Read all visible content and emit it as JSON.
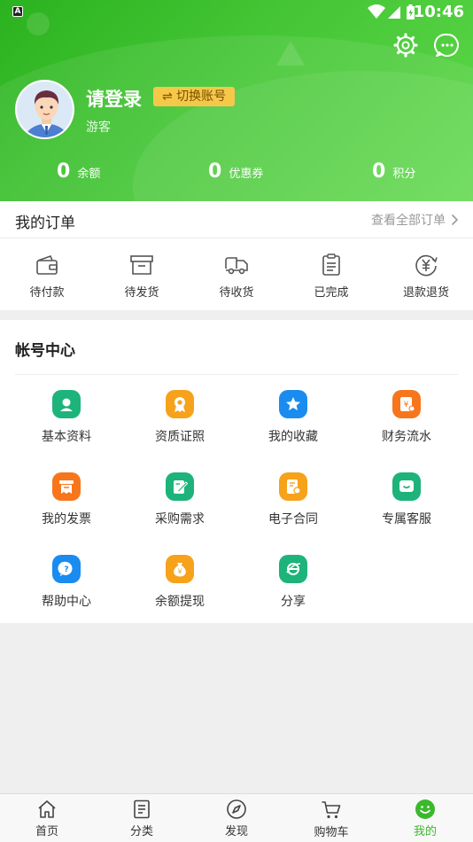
{
  "status_bar": {
    "time": "10:46",
    "badge": "A"
  },
  "profile": {
    "login_label": "请登录",
    "switch_label": "⇌ 切换账号",
    "role": "游客"
  },
  "stats": [
    {
      "value": "0",
      "label": "余额"
    },
    {
      "value": "0",
      "label": "优惠券"
    },
    {
      "value": "0",
      "label": "积分"
    }
  ],
  "orders": {
    "title": "我的订单",
    "view_all": "查看全部订单",
    "items": [
      {
        "label": "待付款",
        "icon": "wallet-icon"
      },
      {
        "label": "待发货",
        "icon": "box-icon"
      },
      {
        "label": "待收货",
        "icon": "truck-icon"
      },
      {
        "label": "已完成",
        "icon": "clipboard-icon"
      },
      {
        "label": "退款退货",
        "icon": "refund-icon"
      }
    ]
  },
  "account": {
    "title": "帐号中心",
    "items": [
      {
        "label": "基本资料",
        "icon": "profile-icon",
        "color": "#1db37a"
      },
      {
        "label": "资质证照",
        "icon": "certificate-icon",
        "color": "#f7a21b"
      },
      {
        "label": "我的收藏",
        "icon": "star-icon",
        "color": "#1a8cf0"
      },
      {
        "label": "财务流水",
        "icon": "finance-icon",
        "color": "#f7761b"
      },
      {
        "label": "我的发票",
        "icon": "invoice-icon",
        "color": "#f7761b"
      },
      {
        "label": "采购需求",
        "icon": "edit-icon",
        "color": "#1db37a"
      },
      {
        "label": "电子合同",
        "icon": "contract-icon",
        "color": "#f7a21b"
      },
      {
        "label": "专属客服",
        "icon": "chat-icon",
        "color": "#1db37a"
      },
      {
        "label": "帮助中心",
        "icon": "help-icon",
        "color": "#1a8cf0"
      },
      {
        "label": "余额提现",
        "icon": "money-bag-icon",
        "color": "#f7a21b"
      },
      {
        "label": "分享",
        "icon": "share-icon",
        "color": "#1db37a"
      }
    ]
  },
  "tabs": [
    {
      "label": "首页",
      "icon": "home-icon"
    },
    {
      "label": "分类",
      "icon": "category-icon"
    },
    {
      "label": "发现",
      "icon": "compass-icon"
    },
    {
      "label": "购物车",
      "icon": "cart-icon"
    },
    {
      "label": "我的",
      "icon": "smiley-icon",
      "active": true
    }
  ],
  "colors": {
    "brand_green": "#3cb82d",
    "badge_yellow": "#f5c84a"
  }
}
